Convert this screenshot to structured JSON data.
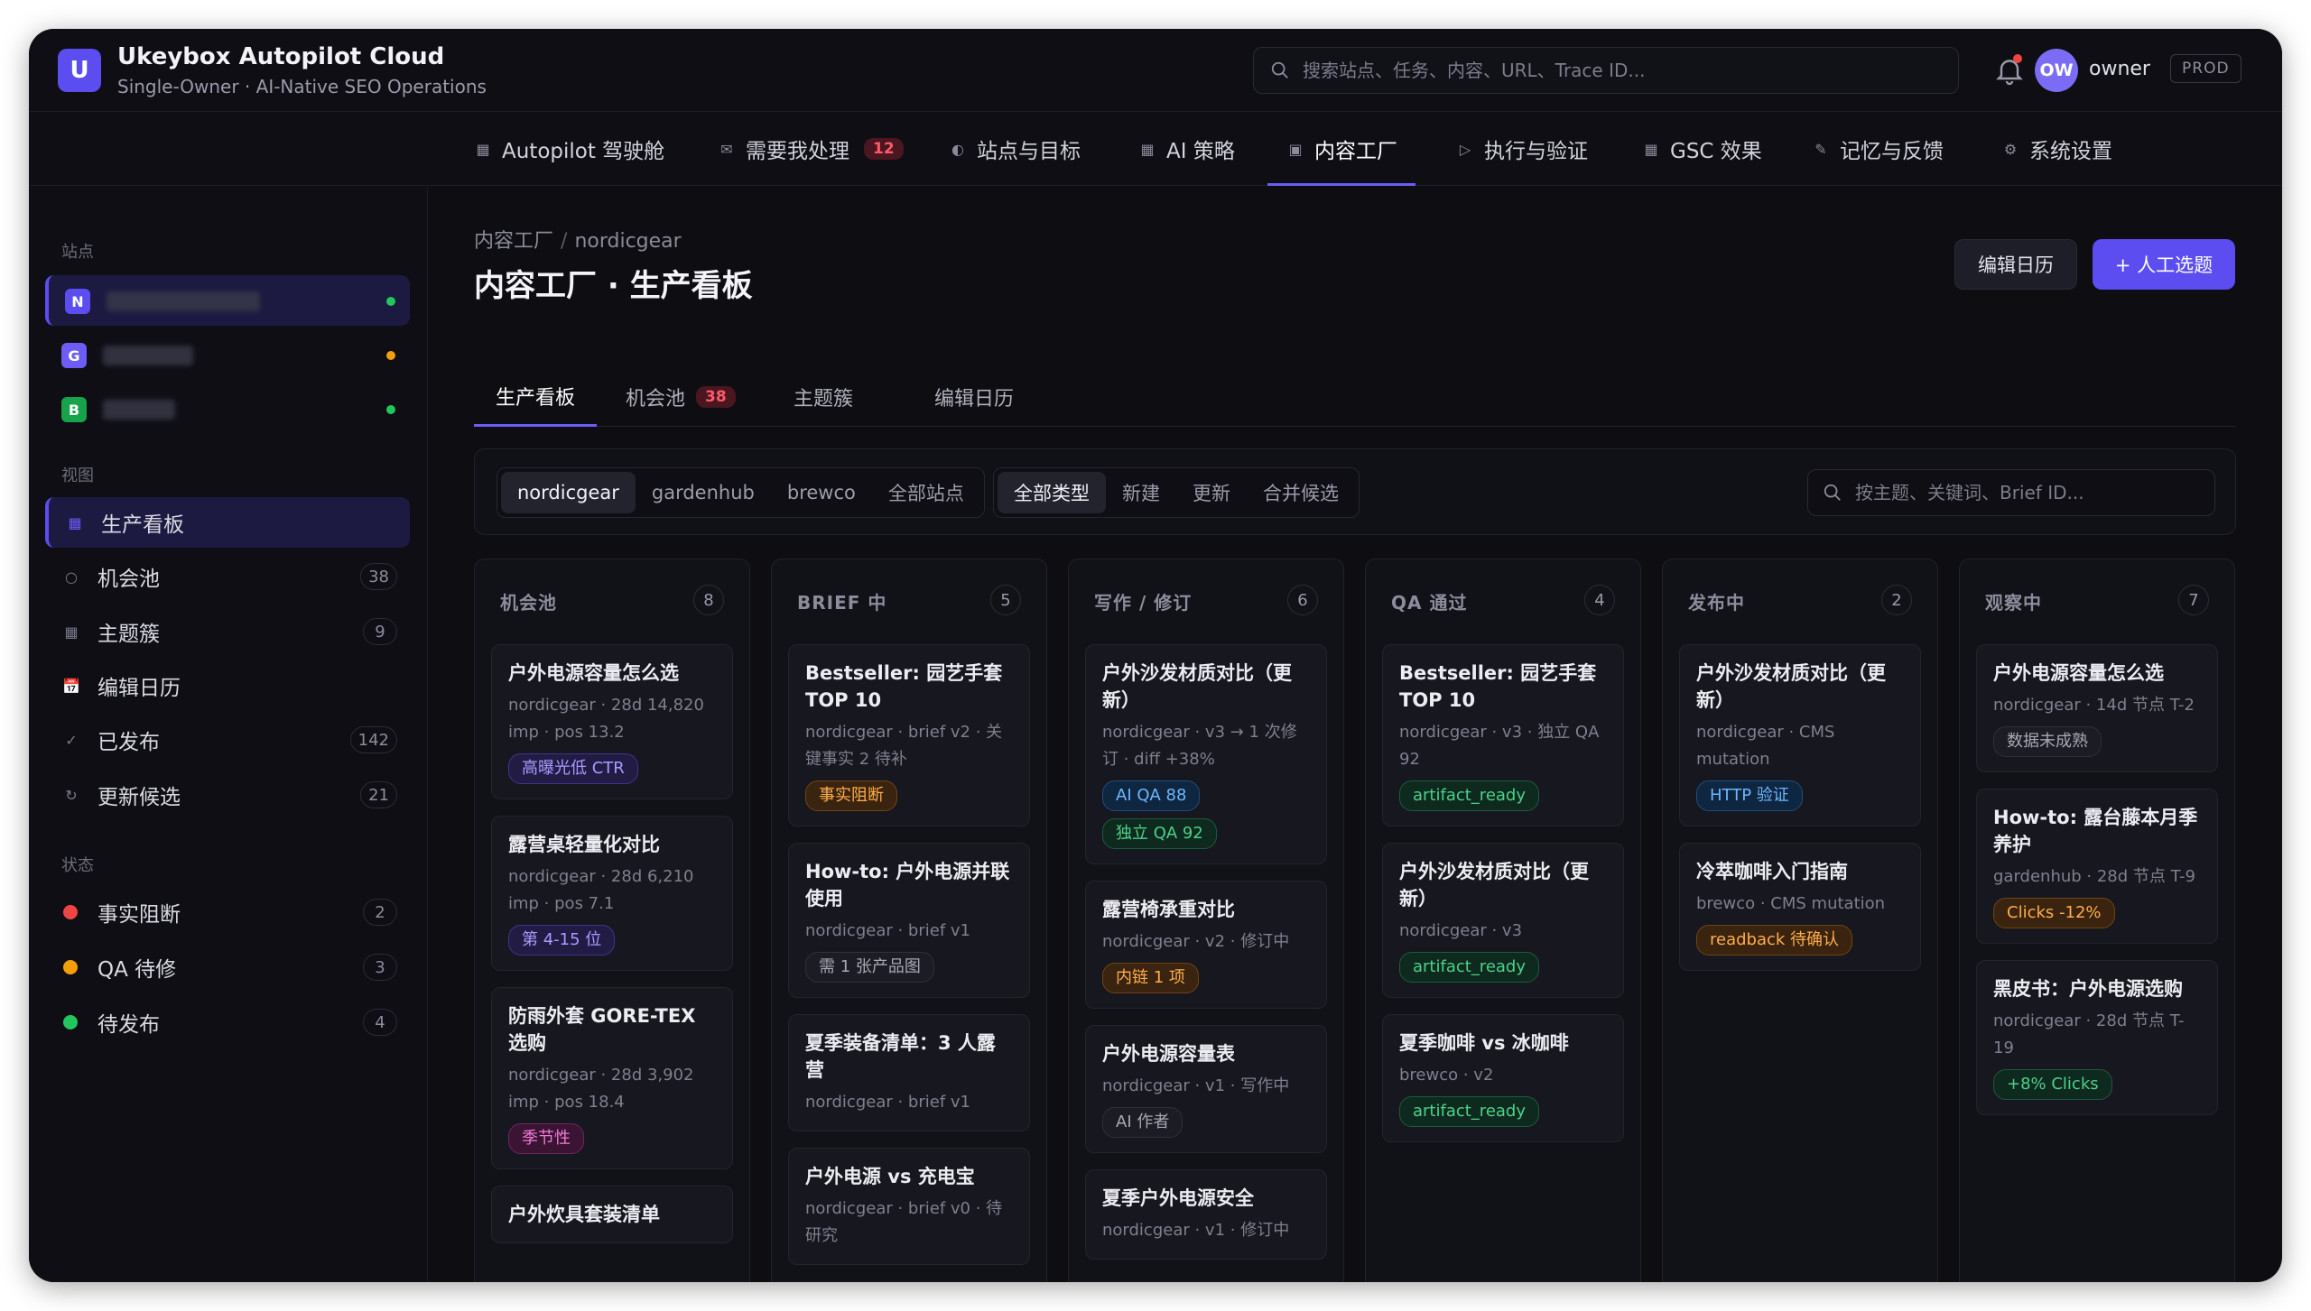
{
  "app": {
    "logo_letter": "U",
    "title": "Ukeybox Autopilot Cloud",
    "subtitle": "Single-Owner · AI-Native SEO Operations",
    "search_placeholder": "搜索站点、任务、内容、URL、Trace ID...",
    "user_initials": "OW",
    "user_name": "owner",
    "env_badge": "PROD"
  },
  "topnav": [
    {
      "label": "Autopilot 驾驶舱",
      "icon": "grid-icon",
      "glyph": "▦"
    },
    {
      "label": "需要我处理",
      "icon": "inbox-icon",
      "glyph": "✉",
      "badge": "12"
    },
    {
      "label": "站点与目标",
      "icon": "target-icon",
      "glyph": "◐"
    },
    {
      "label": "AI 策略",
      "icon": "strategy-icon",
      "glyph": "▦"
    },
    {
      "label": "内容工厂",
      "icon": "factory-icon",
      "glyph": "▣",
      "active": true
    },
    {
      "label": "执行与验证",
      "icon": "play-icon",
      "glyph": "▷"
    },
    {
      "label": "GSC 效果",
      "icon": "chart-icon",
      "glyph": "▦"
    },
    {
      "label": "记忆与反馈",
      "icon": "pen-icon",
      "glyph": "✎"
    },
    {
      "label": "系统设置",
      "icon": "gear-icon",
      "glyph": "⚙"
    }
  ],
  "sidebar": {
    "sites_label": "站点",
    "sites": [
      {
        "letter": "N",
        "color": "#5b4df0",
        "status": "#22c55e"
      },
      {
        "letter": "G",
        "color": "#6d5cf5",
        "status": "#f59e0b"
      },
      {
        "letter": "B",
        "color": "#16a34a",
        "status": "#22c55e"
      }
    ],
    "views_label": "视图",
    "views": [
      {
        "label": "生产看板",
        "icon": "board-icon",
        "glyph": "▦",
        "count": "",
        "active": true
      },
      {
        "label": "机会池",
        "icon": "circle-icon",
        "glyph": "○",
        "count": "38"
      },
      {
        "label": "主题簇",
        "icon": "cluster-icon",
        "glyph": "▦",
        "count": "9"
      },
      {
        "label": "编辑日历",
        "icon": "calendar-icon",
        "glyph": "📅",
        "count": ""
      },
      {
        "label": "已发布",
        "icon": "check-icon",
        "glyph": "✓",
        "count": "142"
      },
      {
        "label": "更新候选",
        "icon": "refresh-icon",
        "glyph": "↻",
        "count": "21"
      }
    ],
    "status_label": "状态",
    "statuses": [
      {
        "label": "事实阻断",
        "color": "#ef4444",
        "count": "2"
      },
      {
        "label": "QA 待修",
        "color": "#f59e0b",
        "count": "3"
      },
      {
        "label": "待发布",
        "color": "#22c55e",
        "count": "4"
      }
    ]
  },
  "main": {
    "breadcrumb": [
      "内容工厂",
      "nordicgear"
    ],
    "title": "内容工厂 · 生产看板",
    "btn_calendar": "编辑日历",
    "btn_add": "+ 人工选题",
    "tabs": [
      {
        "label": "生产看板",
        "active": true
      },
      {
        "label": "机会池",
        "badge": "38"
      },
      {
        "label": "主题簇"
      },
      {
        "label": "编辑日历"
      }
    ],
    "site_filters": [
      "nordicgear",
      "gardenhub",
      "brewco",
      "全部站点"
    ],
    "type_filters": [
      "全部类型",
      "新建",
      "更新",
      "合并候选"
    ],
    "filter_search_placeholder": "按主题、关键词、Brief ID..."
  },
  "kanban": [
    {
      "title": "机会池",
      "count": "8",
      "cards": [
        {
          "title": "户外电源容量怎么选",
          "meta": "nordicgear · 28d 14,820 imp · pos 13.2",
          "tags": [
            {
              "text": "高曝光低 CTR",
              "style": "purple"
            }
          ]
        },
        {
          "title": "露营桌轻量化对比",
          "meta": "nordicgear · 28d 6,210 imp · pos 7.1",
          "tags": [
            {
              "text": "第 4-15 位",
              "style": "purple"
            }
          ]
        },
        {
          "title": "防雨外套 GORE-TEX 选购",
          "meta": "nordicgear · 28d 3,902 imp · pos 18.4",
          "tags": [
            {
              "text": "季节性",
              "style": "pink"
            }
          ]
        },
        {
          "title": "户外炊具套装清单",
          "meta": "",
          "tags": []
        }
      ]
    },
    {
      "title": "BRIEF 中",
      "count": "5",
      "cards": [
        {
          "title": "Bestseller: 园艺手套 TOP 10",
          "meta": "nordicgear · brief v2 · 关键事实 2 待补",
          "tags": [
            {
              "text": "事实阻断",
              "style": "orange"
            }
          ]
        },
        {
          "title": "How-to: 户外电源并联使用",
          "meta": "nordicgear · brief v1",
          "tags": [
            {
              "text": "需 1 张产品图",
              "style": "gray"
            }
          ]
        },
        {
          "title": "夏季装备清单：3 人露营",
          "meta": "nordicgear · brief v1",
          "tags": []
        },
        {
          "title": "户外电源 vs 充电宝",
          "meta": "nordicgear · brief v0 · 待研究",
          "tags": []
        }
      ]
    },
    {
      "title": "写作 / 修订",
      "count": "6",
      "cards": [
        {
          "title": "户外沙发材质对比（更新）",
          "meta": "nordicgear · v3 → 1 次修订 · diff +38%",
          "tags": [
            {
              "text": "AI QA 88",
              "style": "blue"
            },
            {
              "text": "独立 QA 92",
              "style": "green"
            }
          ]
        },
        {
          "title": "露营椅承重对比",
          "meta": "nordicgear · v2 · 修订中",
          "tags": [
            {
              "text": "内链 1 项",
              "style": "orange"
            }
          ]
        },
        {
          "title": "户外电源容量表",
          "meta": "nordicgear · v1 · 写作中",
          "tags": [
            {
              "text": "AI 作者",
              "style": "gray"
            }
          ]
        },
        {
          "title": "夏季户外电源安全",
          "meta": "nordicgear · v1 · 修订中",
          "tags": []
        }
      ]
    },
    {
      "title": "QA 通过",
      "count": "4",
      "cards": [
        {
          "title": "Bestseller: 园艺手套 TOP 10",
          "meta": "nordicgear · v3 · 独立 QA 92",
          "tags": [
            {
              "text": "artifact_ready",
              "style": "green"
            }
          ]
        },
        {
          "title": "户外沙发材质对比（更新）",
          "meta": "nordicgear · v3",
          "tags": [
            {
              "text": "artifact_ready",
              "style": "green"
            }
          ]
        },
        {
          "title": "夏季咖啡 vs 冰咖啡",
          "meta": "brewco · v2",
          "tags": [
            {
              "text": "artifact_ready",
              "style": "green"
            }
          ]
        }
      ]
    },
    {
      "title": "发布中",
      "count": "2",
      "cards": [
        {
          "title": "户外沙发材质对比（更新）",
          "meta": "nordicgear · CMS mutation",
          "tags": [
            {
              "text": "HTTP 验证",
              "style": "blue"
            }
          ]
        },
        {
          "title": "冷萃咖啡入门指南",
          "meta": "brewco · CMS mutation",
          "tags": [
            {
              "text": "readback 待确认",
              "style": "orange"
            }
          ]
        }
      ]
    },
    {
      "title": "观察中",
      "count": "7",
      "cards": [
        {
          "title": "户外电源容量怎么选",
          "meta": "nordicgear · 14d 节点 T-2",
          "tags": [
            {
              "text": "数据未成熟",
              "style": "gray"
            }
          ]
        },
        {
          "title": "How-to: 露台藤本月季养护",
          "meta": "gardenhub · 28d 节点 T-9",
          "tags": [
            {
              "text": "Clicks -12%",
              "style": "orange"
            }
          ]
        },
        {
          "title": "黑皮书：户外电源选购",
          "meta": "nordicgear · 28d 节点 T-19",
          "tags": [
            {
              "text": "+8% Clicks",
              "style": "green"
            }
          ]
        }
      ]
    }
  ]
}
